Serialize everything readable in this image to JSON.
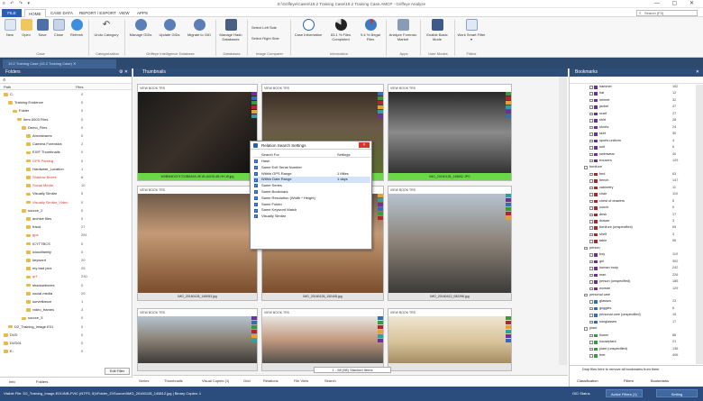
{
  "titlebar": {
    "title": "E:\\Griffeye\\Cases\\19.2 Training Case\\19.2 Training Case.AMCP - Griffeye Analyze",
    "quick_access": "≡ ↶ ↷ ▾",
    "window_controls": "— ▢ ✕"
  },
  "menu": {
    "file": "FILE",
    "tabs": [
      "HOME",
      "CASE DATA",
      "REPORT / EXPORT",
      "VIEW",
      "APPS"
    ],
    "active_tab": "HOME",
    "search_placeholder": "Search (F3)"
  },
  "ribbon": {
    "buttons": [
      {
        "label": "New",
        "icon": "new-case-icon"
      },
      {
        "label": "Open",
        "icon": "open-case-icon"
      },
      {
        "label": "Save",
        "icon": "save-icon"
      },
      {
        "label": "Close",
        "icon": "close-case-icon"
      },
      {
        "label": "Refresh",
        "icon": "refresh-icon"
      },
      {
        "label": "Undo Category",
        "icon": "undo-icon"
      },
      {
        "label": "Manage GIDs",
        "icon": "manage-gids-icon"
      },
      {
        "label": "Update GIDs",
        "icon": "update-gids-icon"
      },
      {
        "label": "Migrate to GID",
        "icon": "migrate-icon"
      },
      {
        "label": "Manage Hash Databases",
        "icon": "hash-db-icon"
      },
      {
        "label": "Case Information",
        "icon": "info-icon"
      },
      {
        "label": "83.1 % Files Completed",
        "icon": "progress-pie-icon"
      },
      {
        "label": "9.4 % Illegal Files",
        "icon": "illegal-pie-icon"
      },
      {
        "label": "Analyze Forensic Market",
        "icon": "market-icon"
      },
      {
        "label": "Enable Basic Mode",
        "icon": "basic-mode-icon"
      },
      {
        "label": "Work Smart Filter ▾",
        "icon": "filter-icon"
      }
    ],
    "small_buttons": [
      "Select Left Side",
      "Select Right Side"
    ],
    "groups": [
      "Case",
      "Categorization",
      "Griffeye Intelligence Database",
      "Databases",
      "Image Comparer",
      "Information",
      "Apps",
      "User Modes",
      "Filters"
    ]
  },
  "doc_tab": {
    "label": "19.2 Training Case (19.2 Training Case)  ✕"
  },
  "folders": {
    "title": "Folders",
    "path_header": "Path",
    "files_header": "Files",
    "rows": [
      {
        "label": "C:",
        "indent": 0,
        "files": "0",
        "color": ""
      },
      {
        "label": "Training Evidence",
        "indent": 1,
        "files": "0",
        "color": ""
      },
      {
        "label": "Folder",
        "indent": 2,
        "files": "0",
        "color": ""
      },
      {
        "label": "Item 0003 Files",
        "indent": 3,
        "files": "0",
        "color": ""
      },
      {
        "label": "Demo_Files",
        "indent": 4,
        "files": "0",
        "color": ""
      },
      {
        "label": "Armesbares",
        "indent": 5,
        "files": "0",
        "color": ""
      },
      {
        "label": "Camera Forensics",
        "indent": 5,
        "files": "2",
        "color": ""
      },
      {
        "label": "EXIF Thumbnails",
        "indent": 5,
        "files": "0",
        "color": ""
      },
      {
        "label": "GPS Parsing",
        "indent": 5,
        "files": "0",
        "color": "red"
      },
      {
        "label": "Hardware_Location",
        "indent": 5,
        "files": "1",
        "color": ""
      },
      {
        "label": "Shadow Boxes",
        "indent": 5,
        "files": "8",
        "color": "red"
      },
      {
        "label": "Social Media",
        "indent": 5,
        "files": "10",
        "color": "red"
      },
      {
        "label": "Visually Similar",
        "indent": 5,
        "files": "5",
        "color": ""
      },
      {
        "label": "Visually Similar_Video",
        "indent": 5,
        "files": "0",
        "color": "red"
      },
      {
        "label": "source_2",
        "indent": 4,
        "files": "0",
        "color": ""
      },
      {
        "label": "archive files",
        "indent": 5,
        "files": "0",
        "color": ""
      },
      {
        "label": "fraud",
        "indent": 5,
        "files": "27",
        "color": ""
      },
      {
        "label": "gps",
        "indent": 5,
        "files": "281",
        "color": "red"
      },
      {
        "label": "ICYTTBCS",
        "indent": 5,
        "files": "0",
        "color": ""
      },
      {
        "label": "icloudfamily",
        "indent": 5,
        "files": "0",
        "color": ""
      },
      {
        "label": "keyword",
        "indent": 5,
        "files": "20",
        "color": ""
      },
      {
        "label": "my bad pics",
        "indent": 5,
        "files": "25",
        "color": ""
      },
      {
        "label": "qrT",
        "indent": 5,
        "files": "230",
        "color": "red"
      },
      {
        "label": "shadowboxes",
        "indent": 5,
        "files": "0",
        "color": ""
      },
      {
        "label": "social media",
        "indent": 5,
        "files": "29",
        "color": ""
      },
      {
        "label": "surveillance",
        "indent": 5,
        "files": "1",
        "color": ""
      },
      {
        "label": "video_frames",
        "indent": 5,
        "files": "3",
        "color": ""
      },
      {
        "label": "source_3",
        "indent": 4,
        "files": "0",
        "color": ""
      },
      {
        "label": "D2_Training_Image.E01",
        "indent": 1,
        "files": "0",
        "color": ""
      },
      {
        "label": "DVD",
        "indent": 0,
        "files": "0",
        "color": ""
      },
      {
        "label": "DVD01",
        "indent": 0,
        "files": "0",
        "color": ""
      },
      {
        "label": "E:",
        "indent": 0,
        "files": "0",
        "color": ""
      }
    ],
    "footer_tabs": [
      "Info",
      "Folders"
    ],
    "edit_filter": "Edit Filter"
  },
  "thumbnails": {
    "title": "Thumbnails",
    "toolbar": "VIEW  BOOK  TRS",
    "items": [
      {
        "caption": "W0BW4DCF47D2B8A9A-9E1B-A0CB-4B-HH-W.jpg",
        "green": true,
        "scene": "dark"
      },
      {
        "caption": "",
        "green": true,
        "scene": "figures"
      },
      {
        "caption": "IMG_20160128_145652.JPG",
        "green": true,
        "scene": "figures_gray"
      },
      {
        "caption": "IMG_20160128_145053.jpg",
        "green": false,
        "scene": "dinner"
      },
      {
        "caption": "IMG_20160128_152408.jpg",
        "green": false,
        "scene": "dinner"
      },
      {
        "caption": "IMG_20160412_082296.jpg",
        "green": false,
        "scene": "car"
      },
      {
        "caption": "",
        "green": false,
        "scene": "car"
      },
      {
        "caption": "",
        "green": false,
        "scene": "face"
      },
      {
        "caption": "",
        "green": false,
        "scene": "room"
      }
    ],
    "pager": "1 - 98 (98) Stacked Items"
  },
  "bottom_tabs": [
    "Series",
    "Thumbnails",
    "Visual Copies (1)",
    "Grid",
    "Relations",
    "File View",
    "Search"
  ],
  "dialog": {
    "title": "Relation Search Settings",
    "col_search_for": "Search For",
    "col_settings": "Settings",
    "rows": [
      {
        "name": "Hash",
        "value": "",
        "checked": true
      },
      {
        "name": "Same Exif Serial Number",
        "value": "",
        "checked": true
      },
      {
        "name": "Within GPS Range",
        "value": "1 Miles",
        "checked": true
      },
      {
        "name": "Within Date Range",
        "value": "1 days",
        "checked": true
      },
      {
        "name": "Same Series",
        "value": "",
        "checked": true
      },
      {
        "name": "Same Bookmark",
        "value": "",
        "checked": true
      },
      {
        "name": "Same Resolution (Width * Height)",
        "value": "",
        "checked": true
      },
      {
        "name": "Same Folder",
        "value": "",
        "checked": true
      },
      {
        "name": "Same Keyword Match",
        "value": "",
        "checked": true
      },
      {
        "name": "Visually Similar",
        "value": "",
        "checked": true
      }
    ]
  },
  "bookmarks": {
    "title": "Bookmarks",
    "rows": [
      {
        "label": "hammer",
        "count": "162",
        "color": "#6b2fa0",
        "indent": 2
      },
      {
        "label": "hat",
        "count": "12",
        "color": "#6b2fa0",
        "indent": 2
      },
      {
        "label": "helmet",
        "count": "32",
        "color": "#6b2fa0",
        "indent": 2
      },
      {
        "label": "jacket",
        "count": "47",
        "color": "#6b2fa0",
        "indent": 2
      },
      {
        "label": "scarf",
        "count": "27",
        "color": "#6b2fa0",
        "indent": 2
      },
      {
        "label": "shirt",
        "count": "28",
        "color": "#6b2fa0",
        "indent": 2
      },
      {
        "label": "shorts",
        "count": "24",
        "color": "#6b2fa0",
        "indent": 2
      },
      {
        "label": "skirt",
        "count": "30",
        "color": "#6b2fa0",
        "indent": 2
      },
      {
        "label": "sports uniform",
        "count": "4",
        "color": "#6b2fa0",
        "indent": 2
      },
      {
        "label": "suit",
        "count": "6",
        "color": "#6b2fa0",
        "indent": 2
      },
      {
        "label": "swimwear",
        "count": "40",
        "color": "#6b2fa0",
        "indent": 2
      },
      {
        "label": "trousers",
        "count": "129",
        "color": "#6b2fa0",
        "indent": 2
      },
      {
        "label": "furniture",
        "count": "",
        "color": "",
        "indent": 1
      },
      {
        "label": "bed",
        "count": "63",
        "color": "#b5242e",
        "indent": 2
      },
      {
        "label": "bench",
        "count": "147",
        "color": "#b5242e",
        "indent": 2
      },
      {
        "label": "cabinetry",
        "count": "11",
        "color": "#b5242e",
        "indent": 2
      },
      {
        "label": "chair",
        "count": "110",
        "color": "#b5242e",
        "indent": 2
      },
      {
        "label": "chest of drawers",
        "count": "5",
        "color": "#b5242e",
        "indent": 2
      },
      {
        "label": "couch",
        "count": "5",
        "color": "#b5242e",
        "indent": 2
      },
      {
        "label": "desk",
        "count": "17",
        "color": "#b5242e",
        "indent": 2
      },
      {
        "label": "drawer",
        "count": "3",
        "color": "#b5242e",
        "indent": 2
      },
      {
        "label": "furniture (unspecified)",
        "count": "69",
        "color": "#b5242e",
        "indent": 2
      },
      {
        "label": "shelf",
        "count": "3",
        "color": "#b5242e",
        "indent": 2
      },
      {
        "label": "table",
        "count": "96",
        "color": "#b5242e",
        "indent": 2
      },
      {
        "label": "person",
        "count": "",
        "color": "",
        "indent": 1
      },
      {
        "label": "boy",
        "count": "110",
        "color": "#7a2a8c",
        "indent": 2
      },
      {
        "label": "girl",
        "count": "302",
        "color": "#7a2a8c",
        "indent": 2
      },
      {
        "label": "human body",
        "count": "242",
        "color": "#7a2a8c",
        "indent": 2
      },
      {
        "label": "man",
        "count": "226",
        "color": "#7a2a8c",
        "indent": 2
      },
      {
        "label": "person (unspecified)",
        "count": "185",
        "color": "#7a2a8c",
        "indent": 2
      },
      {
        "label": "woman",
        "count": "129",
        "color": "#7a2a8c",
        "indent": 2
      },
      {
        "label": "personal care",
        "count": "",
        "color": "",
        "indent": 1
      },
      {
        "label": "glasses",
        "count": "23",
        "color": "#2f6fb3",
        "indent": 2
      },
      {
        "label": "goggles",
        "count": "6",
        "color": "#2f6fb3",
        "indent": 2
      },
      {
        "label": "personal care (unspecified)",
        "count": "15",
        "color": "#2f6fb3",
        "indent": 2
      },
      {
        "label": "sunglasses",
        "count": "17",
        "color": "#2f6fb3",
        "indent": 2
      },
      {
        "label": "plant",
        "count": "",
        "color": "",
        "indent": 1
      },
      {
        "label": "flower",
        "count": "88",
        "color": "#3a9a3a",
        "indent": 2
      },
      {
        "label": "houseplant",
        "count": "21",
        "color": "#3a9a3a",
        "indent": 2
      },
      {
        "label": "plant (unspecified)",
        "count": "136",
        "color": "#3a9a3a",
        "indent": 2
      },
      {
        "label": "tree",
        "count": "406",
        "color": "#3a9a3a",
        "indent": 2
      }
    ],
    "drop_hint": "Drop files here to remove all bookmarks from them",
    "footer_tabs": [
      "Classification",
      "Filters",
      "Bookmarks"
    ]
  },
  "status": {
    "left": "Visible File: D2_Training_Image.E01\\\\NB-FVIC (NTFS, 5)\\\\Folder_Z\\\\Source\\\\IMG_20160128_145812.jpg | Binary Copies: 1",
    "gid_status": "GID Status",
    "active_filters": "Active Filters (1)",
    "setting": "Setting"
  }
}
